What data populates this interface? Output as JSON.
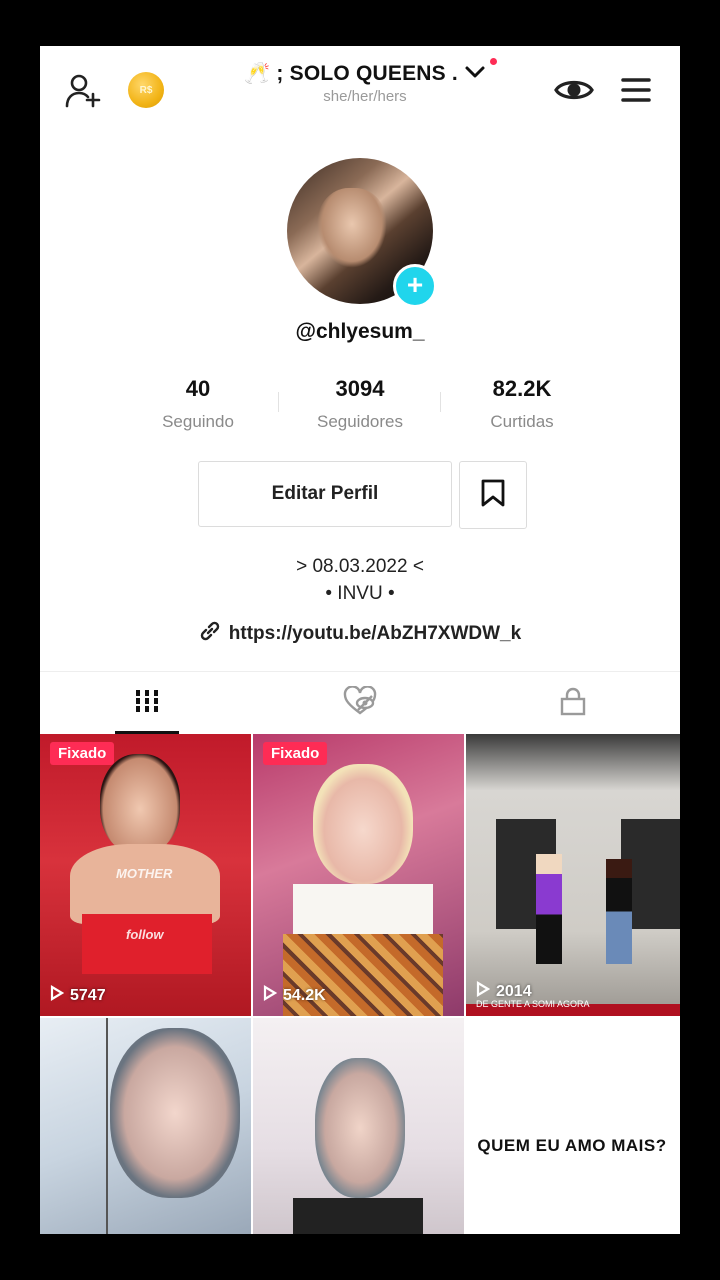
{
  "header": {
    "title": "🥂 ; SOLO QUEENS .",
    "pronouns": "she/her/hers",
    "coin_label": "R$"
  },
  "profile": {
    "username": "@chlyesum_",
    "stats": [
      {
        "value": "40",
        "label": "Seguindo"
      },
      {
        "value": "3094",
        "label": "Seguidores"
      },
      {
        "value": "82.2K",
        "label": "Curtidas"
      }
    ],
    "edit_button": "Editar Perfil",
    "bio_line1": "> 08.03.2022 <",
    "bio_line2": "• INVU •",
    "link": "https://youtu.be/AbZH7XWDW_k"
  },
  "tabs": [
    "videos-grid",
    "liked-hidden",
    "private"
  ],
  "videos": [
    {
      "pinned": "Fixado",
      "views": "5747",
      "overlay1": "MOTHER",
      "overlay2": "follow"
    },
    {
      "pinned": "Fixado",
      "views": "54.2K"
    },
    {
      "views": "2014",
      "caption": "DE GENTE A SOMI AGORA"
    },
    {},
    {},
    {
      "caption": "QUEM EU AMO MAIS?"
    }
  ],
  "colors": {
    "accent": "#fe2c55",
    "plus": "#20d5ec",
    "coin": "#f2b417"
  }
}
